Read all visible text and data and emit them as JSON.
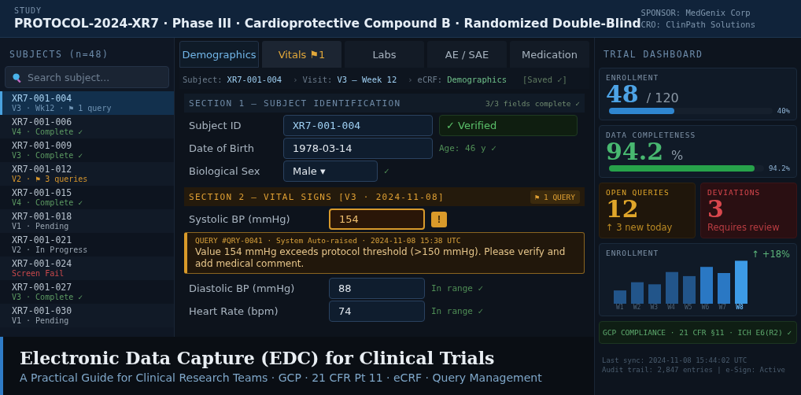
{
  "header": {
    "eyebrow": "STUDY",
    "title": "PROTOCOL-2024-XR7 · Phase III · Cardioprotective Compound B · Randomized Double-Blind",
    "sponsor": "SPONSOR: MedGenix Corp",
    "cro": "CRO: ClinPath Solutions"
  },
  "sidebar": {
    "title": "SUBJECTS (n=48)",
    "search": {
      "placeholder": "Search subject..."
    },
    "items": [
      {
        "id": "XR7-001-004",
        "status": "V3 · Wk12 · ⚑ 1 query",
        "kind": "current",
        "selected": true
      },
      {
        "id": "XR7-001-006",
        "status": "V4 · Complete ✓",
        "kind": "complete",
        "selected": false
      },
      {
        "id": "XR7-001-009",
        "status": "V3 · Complete ✓",
        "kind": "complete",
        "selected": false
      },
      {
        "id": "XR7-001-012",
        "status": "V2 · ⚑ 3 queries",
        "kind": "query",
        "selected": false
      },
      {
        "id": "XR7-001-015",
        "status": "V4 · Complete ✓",
        "kind": "complete",
        "selected": false
      },
      {
        "id": "XR7-001-018",
        "status": "V1 · Pending",
        "kind": "pending",
        "selected": false
      },
      {
        "id": "XR7-001-021",
        "status": "V2 · In Progress",
        "kind": "pending",
        "selected": false
      },
      {
        "id": "XR7-001-024",
        "status": "Screen Fail",
        "kind": "fail",
        "selected": false
      },
      {
        "id": "XR7-001-027",
        "status": "V3 · Complete ✓",
        "kind": "complete",
        "selected": false
      },
      {
        "id": "XR7-001-030",
        "status": "V1 · Pending",
        "kind": "pending",
        "selected": false
      }
    ]
  },
  "tabs": [
    {
      "label": "Demographics",
      "selected": true,
      "alert": false
    },
    {
      "label": "Vitals ⚑1",
      "selected": false,
      "alert": true
    },
    {
      "label": "Labs",
      "selected": false,
      "alert": false
    },
    {
      "label": "AE / SAE",
      "selected": false,
      "alert": false
    },
    {
      "label": "Medication",
      "selected": false,
      "alert": false
    }
  ],
  "breadcrumb": [
    {
      "label": "Subject:",
      "value": "XR7-001-004",
      "kind": "id"
    },
    {
      "label": "Visit:",
      "value": "V3 — Week 12",
      "kind": "id"
    },
    {
      "label": "eCRF:",
      "value": "Demographics",
      "kind": "form"
    }
  ],
  "breadcrumb_separator": "›",
  "save_state": "[Saved ✓]",
  "sections": [
    {
      "title": "SECTION 1 — SUBJECT IDENTIFICATION",
      "kind": "normal",
      "note": "3/3 fields complete ✓",
      "fields": [
        {
          "label": "Subject ID",
          "value": "XR7-001-004",
          "kind": "id",
          "status": {
            "text": "✓ Verified",
            "kind": "verified"
          }
        },
        {
          "label": "Date of Birth",
          "value": "1978-03-14",
          "kind": "text",
          "status": {
            "text": "Age: 46 y ✓",
            "kind": "ok"
          }
        },
        {
          "label": "Biological Sex",
          "value": "Male ▾",
          "kind": "select",
          "status": {
            "text": "✓",
            "kind": "ok"
          }
        }
      ]
    },
    {
      "title": "SECTION 2 — VITAL SIGNS [V3 · 2024-11-08]",
      "kind": "query",
      "note": "⚑ 1 QUERY",
      "fields": [
        {
          "label": "Systolic BP (mmHg)",
          "value": "154",
          "kind": "flagged",
          "status": {
            "text": "!",
            "kind": "alert"
          },
          "query": {
            "meta": "QUERY #QRY-0041 · System Auto-raised · 2024-11-08 15:38 UTC",
            "message": "Value 154 mmHg exceeds protocol threshold (>150 mmHg). Please verify and add medical comment."
          }
        },
        {
          "label": "Diastolic BP (mmHg)",
          "value": "88",
          "kind": "text",
          "status": {
            "text": "In range ✓",
            "kind": "ok"
          }
        },
        {
          "label": "Heart Rate (bpm)",
          "value": "74",
          "kind": "text",
          "status": {
            "text": "In range ✓",
            "kind": "ok"
          }
        }
      ]
    }
  ],
  "dashboard": {
    "title": "TRIAL DASHBOARD",
    "enrollment": {
      "label": "ENROLLMENT",
      "value": "48",
      "total": "/ 120",
      "level": 0.4,
      "reading": "40%"
    },
    "completeness": {
      "label": "DATA COMPLETENESS",
      "value": "94.2",
      "unit": "%",
      "level": 0.942,
      "reading": "94.2%"
    },
    "tiles": [
      {
        "label": "OPEN QUERIES",
        "value": "12",
        "note": "↑ 3 new today",
        "kind": "warning"
      },
      {
        "label": "DEVIATIONS",
        "value": "3",
        "note": "Requires review",
        "kind": "danger"
      }
    ],
    "weekly": {
      "title": "ENROLLMENT",
      "trend": "↑ +18%",
      "weeks": [
        {
          "label": "W1",
          "selected": false
        },
        {
          "label": "W2",
          "selected": false
        },
        {
          "label": "W3",
          "selected": false
        },
        {
          "label": "W4",
          "selected": false
        },
        {
          "label": "W5",
          "selected": false
        },
        {
          "label": "W6",
          "selected": false
        },
        {
          "label": "W7",
          "selected": false
        },
        {
          "label": "W8",
          "selected": true
        }
      ]
    },
    "compliance": "GCP COMPLIANCE · 21 CFR §11 · ICH E6(R2) ✓",
    "sync": "Last sync: 2024-11-08 15:44:02 UTC",
    "audit": "Audit trail: 2,847 entries | e-Sign: Active"
  },
  "banner": {
    "title": "Electronic Data Capture (EDC) for Clinical Trials",
    "subtitle": "A Practical Guide for Clinical Research Teams · GCP · 21 CFR Pt 11 · eCRF · Query Management"
  }
}
